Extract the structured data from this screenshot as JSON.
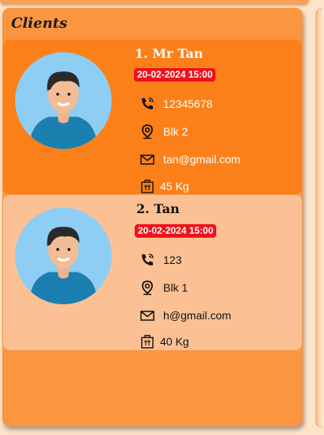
{
  "panel": {
    "title": "Clients"
  },
  "clients": [
    {
      "index_name": "1.  Mr Tan",
      "datetime": "20-02-2024 15:00",
      "phone": "12345678",
      "address": "Blk 2",
      "email": "tan@gmail.com",
      "weight": "45 Kg",
      "selected": true
    },
    {
      "index_name": "2.  Tan",
      "datetime": "20-02-2024 15:00",
      "phone": "123",
      "address": "Blk 1",
      "email": "h@gmail.com",
      "weight": "40 Kg",
      "selected": false
    }
  ],
  "colors": {
    "panel": "#fb9540",
    "selected_card": "#fb8019",
    "card": "#fbc195",
    "badge": "#f0121a"
  }
}
